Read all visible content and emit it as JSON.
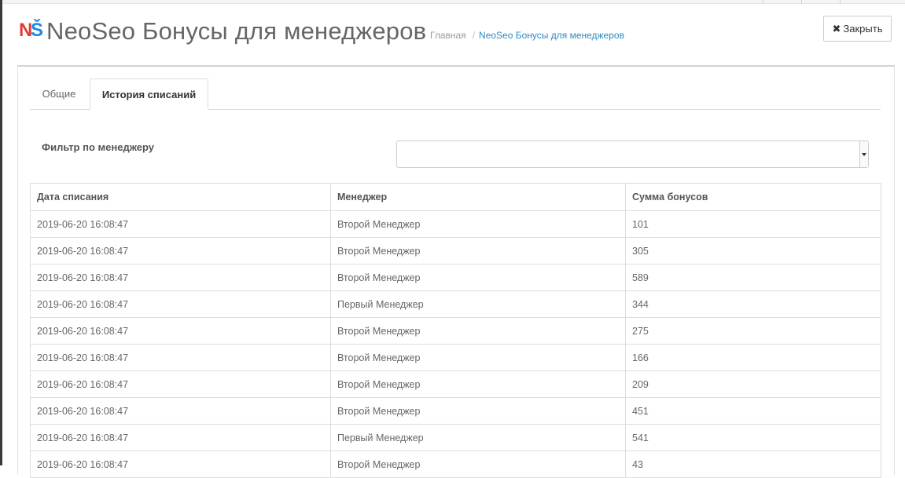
{
  "header": {
    "logo_letters": {
      "n": "N",
      "s": "Š"
    },
    "title": "NeoSeo Бонусы для менеджеров",
    "breadcrumb": {
      "home": "Главная",
      "separator": "/",
      "current": "NeoSeo Бонусы для менеджеров"
    },
    "close_button": {
      "icon": "close-icon",
      "icon_glyph": "✖",
      "label": "Закрыть"
    }
  },
  "tabs": [
    {
      "label": "Общие",
      "active": false
    },
    {
      "label": "История списаний",
      "active": true
    }
  ],
  "filter": {
    "label": "Фильтр по менеджеру",
    "selected": ""
  },
  "table": {
    "headers": [
      "Дата списания",
      "Менеджер",
      "Сумма бонусов"
    ],
    "rows": [
      [
        "2019-06-20 16:08:47",
        "Второй Менеджер",
        "101"
      ],
      [
        "2019-06-20 16:08:47",
        "Второй Менеджер",
        "305"
      ],
      [
        "2019-06-20 16:08:47",
        "Второй Менеджер",
        "589"
      ],
      [
        "2019-06-20 16:08:47",
        "Первый Менеджер",
        "344"
      ],
      [
        "2019-06-20 16:08:47",
        "Второй Менеджер",
        "275"
      ],
      [
        "2019-06-20 16:08:47",
        "Второй Менеджер",
        "166"
      ],
      [
        "2019-06-20 16:08:47",
        "Второй Менеджер",
        "209"
      ],
      [
        "2019-06-20 16:08:47",
        "Второй Менеджер",
        "451"
      ],
      [
        "2019-06-20 16:08:47",
        "Первый Менеджер",
        "541"
      ],
      [
        "2019-06-20 16:08:47",
        "Второй Менеджер",
        "43"
      ]
    ]
  },
  "colors": {
    "logo_n": "#e53935",
    "logo_s": "#1e88e5",
    "link": "#2a8bc2"
  }
}
